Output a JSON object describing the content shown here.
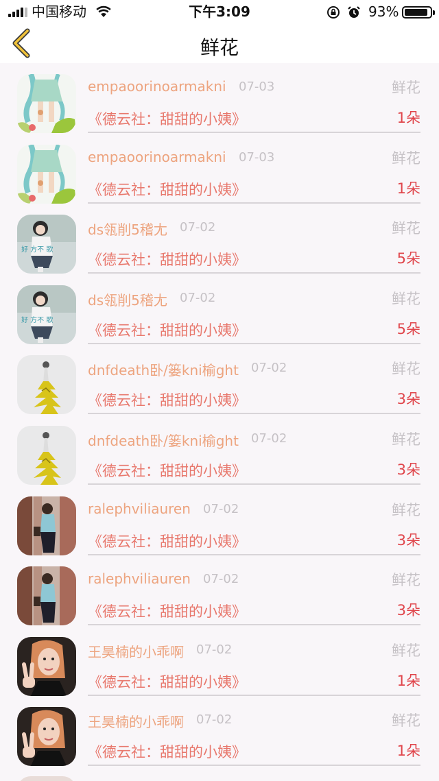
{
  "status_bar": {
    "carrier": "中国移动",
    "time": "下午3:09",
    "battery_percent": "93%",
    "battery_level": 0.93
  },
  "nav": {
    "title": "鲜花",
    "back_icon": "chevron-left-icon",
    "accent_color": "#f0c23a"
  },
  "colors": {
    "name": "#eda47f",
    "show": "#e8786d",
    "count": "#e0454b",
    "muted": "#c6c2c6"
  },
  "rows": [
    {
      "name": "empaoorinoarmakni",
      "date": "07-03",
      "gift": "鲜花",
      "show": "《德云社：甜甜的小姨》",
      "count": "1朵",
      "avatar": "anime-girl"
    },
    {
      "name": "empaoorinoarmakni",
      "date": "07-03",
      "gift": "鲜花",
      "show": "《德云社：甜甜的小姨》",
      "count": "1朵",
      "avatar": "anime-girl"
    },
    {
      "name": "ds瓴削5稽尢",
      "date": "07-02",
      "gift": "鲜花",
      "show": "《德云社：甜甜的小姨》",
      "count": "5朵",
      "avatar": "sitting-girl"
    },
    {
      "name": "ds瓴削5稽尢",
      "date": "07-02",
      "gift": "鲜花",
      "show": "《德云社：甜甜的小姨》",
      "count": "5朵",
      "avatar": "sitting-girl"
    },
    {
      "name": "dnfdeath卧/篓kni榆ght",
      "date": "07-02",
      "gift": "鲜花",
      "show": "《德云社：甜甜的小姨》",
      "count": "3朵",
      "avatar": "yellow-dress"
    },
    {
      "name": "dnfdeath卧/篓kni榆ght",
      "date": "07-02",
      "gift": "鲜花",
      "show": "《德云社：甜甜的小姨》",
      "count": "3朵",
      "avatar": "yellow-dress"
    },
    {
      "name": "ralephviliauren",
      "date": "07-02",
      "gift": "鲜花",
      "show": "《德云社：甜甜的小姨》",
      "count": "3朵",
      "avatar": "tree-girl"
    },
    {
      "name": "ralephviliauren",
      "date": "07-02",
      "gift": "鲜花",
      "show": "《德云社：甜甜的小姨》",
      "count": "3朵",
      "avatar": "tree-girl"
    },
    {
      "name": "王昊楠的小乖啊",
      "date": "07-02",
      "gift": "鲜花",
      "show": "《德云社：甜甜的小姨》",
      "count": "1朵",
      "avatar": "peace-sign-girl"
    },
    {
      "name": "王昊楠的小乖啊",
      "date": "07-02",
      "gift": "鲜花",
      "show": "《德云社：甜甜的小姨》",
      "count": "1朵",
      "avatar": "peace-sign-girl"
    }
  ]
}
